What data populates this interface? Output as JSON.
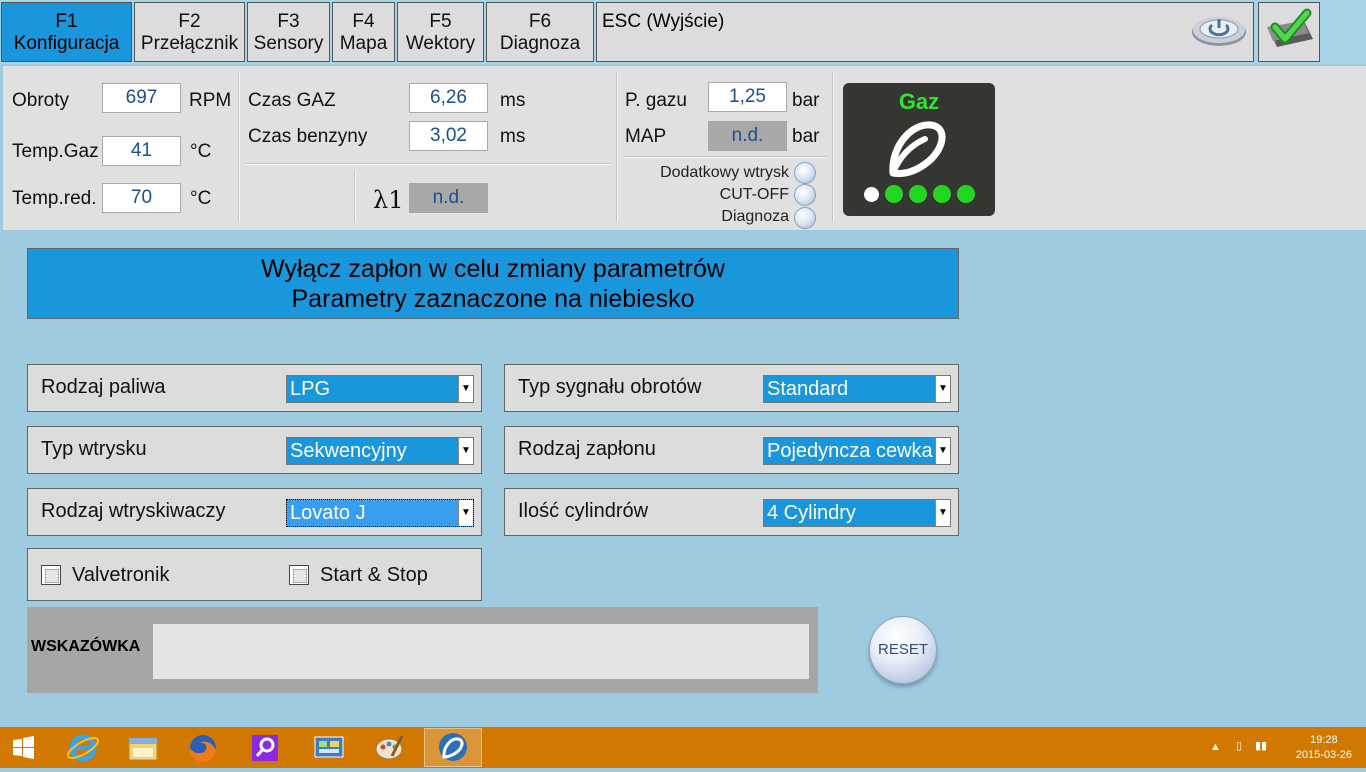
{
  "tabs": [
    {
      "key": "F1",
      "label": "Konfiguracja",
      "active": true
    },
    {
      "key": "F2",
      "label": "Przełącznik"
    },
    {
      "key": "F3",
      "label": "Sensory"
    },
    {
      "key": "F4",
      "label": "Mapa"
    },
    {
      "key": "F5",
      "label": "Wektory"
    },
    {
      "key": "F6",
      "label": "Diagnoza"
    }
  ],
  "esc_label": "ESC (Wyjście)",
  "status": {
    "obroty": {
      "label": "Obroty",
      "value": "697",
      "unit": "RPM"
    },
    "temp_gaz": {
      "label": "Temp.Gaz",
      "value": "41",
      "unit": "°C"
    },
    "temp_red": {
      "label": "Temp.red.",
      "value": "70",
      "unit": "°C"
    },
    "czas_gaz": {
      "label": "Czas GAZ",
      "value": "6,26",
      "unit": "ms"
    },
    "czas_benzyny": {
      "label": "Czas benzyny",
      "value": "3,02",
      "unit": "ms"
    },
    "lambda": {
      "label": "λ1",
      "value": "n.d."
    },
    "p_gazu": {
      "label": "P. gazu",
      "value": "1,25",
      "unit": "bar"
    },
    "map": {
      "label": "MAP",
      "value": "n.d.",
      "unit": "bar"
    },
    "indicators": [
      "Dodatkowy wtrysk",
      "CUT-OFF",
      "Diagnoza"
    ],
    "fuel_box": {
      "title": "Gaz",
      "icon": "gas-switch-icon",
      "active_color": "#2ee52e"
    }
  },
  "message": {
    "line1": "Wyłącz zapłon w celu zmiany parametrów",
    "line2": "Parametry zaznaczone na niebiesko"
  },
  "settings": {
    "rodzaj_paliwa": {
      "label": "Rodzaj paliwa",
      "value": "LPG"
    },
    "typ_wtrysku": {
      "label": "Typ wtrysku",
      "value": "Sekwencyjny"
    },
    "rodzaj_wtryskiwaczy": {
      "label": "Rodzaj wtryskiwaczy",
      "value": "Lovato J"
    },
    "typ_sygnalu": {
      "label": "Typ sygnału obrotów",
      "value": "Standard"
    },
    "rodzaj_zaplonu": {
      "label": "Rodzaj zapłonu",
      "value": "Pojedyncza cewka"
    },
    "ilosc_cylindrow": {
      "label": "Ilość cylindrów",
      "value": "4 Cylindry"
    },
    "valvetronik": {
      "label": "Valvetronik",
      "checked": false
    },
    "start_stop": {
      "label": "Start & Stop",
      "checked": false
    }
  },
  "hint": {
    "label": "WSKAZÓWKA",
    "value": ""
  },
  "reset_label": "RESET",
  "taskbar": {
    "time": "19:28",
    "date": "2015-03-26",
    "accent": "#d07800",
    "apps": [
      "windows-logo",
      "internet-explorer",
      "file-explorer",
      "firefox",
      "magnifier",
      "control-panel",
      "paint",
      "lpg-app"
    ]
  }
}
